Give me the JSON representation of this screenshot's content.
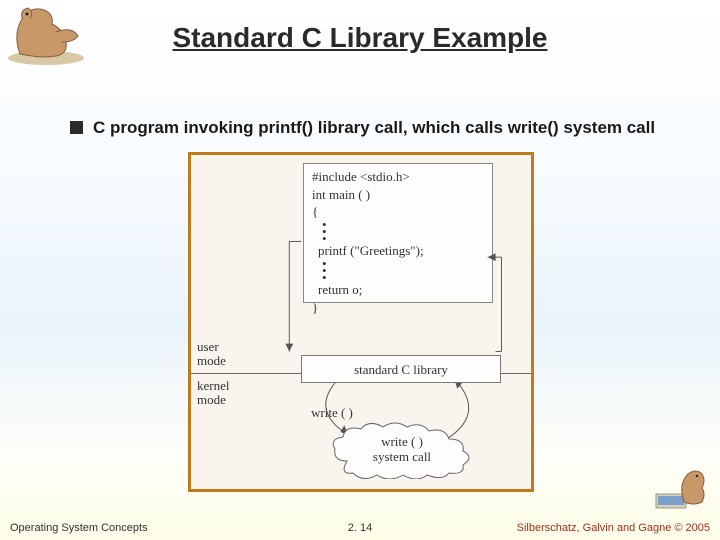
{
  "slide": {
    "title": "Standard C Library Example",
    "bullet": "C program invoking printf() library call, which calls write() system call"
  },
  "diagram": {
    "code": {
      "line1": "#include <stdio.h>",
      "line2": "int main ( )",
      "line3": "{",
      "line4": "printf (\"Greetings\");",
      "line5": "return o;",
      "line6": "}"
    },
    "user_mode": "user\nmode",
    "kernel_mode": "kernel\nmode",
    "clib": "standard C library",
    "write_call": "write ( )",
    "syscall_cloud": "write ( )\nsystem call"
  },
  "footer": {
    "left": "Operating System Concepts",
    "center": "2. 14",
    "right": "Silberschatz, Galvin and Gagne © 2005"
  }
}
